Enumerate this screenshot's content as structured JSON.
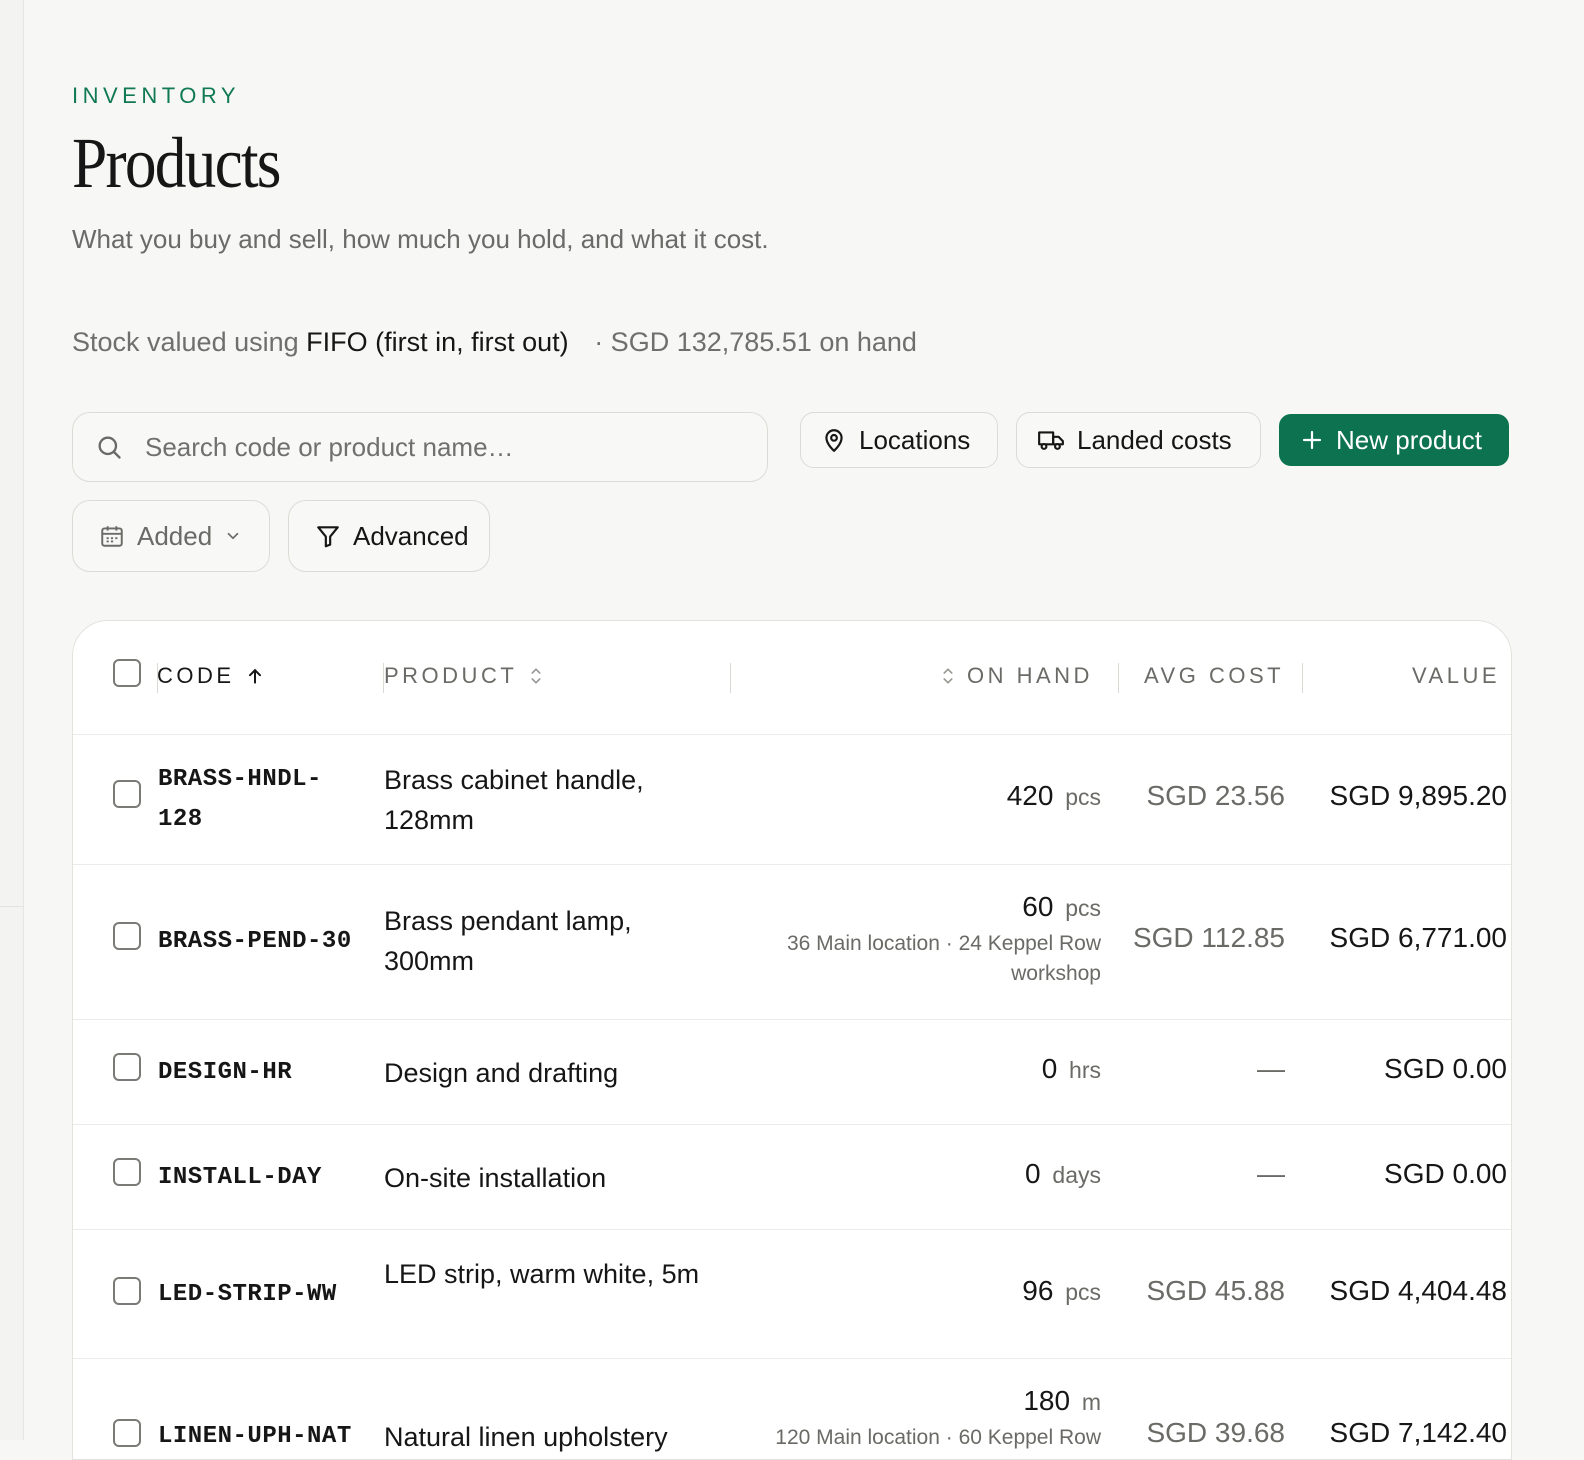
{
  "header": {
    "eyebrow": "INVENTORY",
    "title": "Products",
    "subtitle": "What you buy and sell, how much you hold, and what it cost.",
    "valuation_prefix": "Stock valued using",
    "valuation_method": "FIFO (first in, first out)",
    "valuation_total": "· SGD 132,785.51 on hand"
  },
  "toolbar": {
    "search_placeholder": "Search code or product name…",
    "locations_label": "Locations",
    "landed_costs_label": "Landed costs",
    "new_product_label": "New product",
    "added_filter_label": "Added",
    "advanced_label": "Advanced"
  },
  "table": {
    "columns": {
      "code": "CODE",
      "product": "PRODUCT",
      "on_hand": "ON HAND",
      "avg_cost": "AVG COST",
      "value": "VALUE"
    },
    "rows": [
      {
        "code": "BRASS-HNDL-\n128",
        "product": "Brass cabinet handle, 128mm",
        "qty": "420",
        "unit": "pcs",
        "locations": "",
        "avg_cost": "SGD 23.56",
        "value": "SGD 9,895.20"
      },
      {
        "code": "BRASS-PEND-30",
        "product": "Brass pendant lamp, 300mm",
        "qty": "60",
        "unit": "pcs",
        "locations": "36 Main location · 24 Keppel Row workshop",
        "avg_cost": "SGD 112.85",
        "value": "SGD 6,771.00"
      },
      {
        "code": "DESIGN-HR",
        "product": "Design and drafting",
        "qty": "0",
        "unit": "hrs",
        "locations": "",
        "avg_cost": "—",
        "value": "SGD 0.00"
      },
      {
        "code": "INSTALL-DAY",
        "product": "On-site installation",
        "qty": "0",
        "unit": "days",
        "locations": "",
        "avg_cost": "—",
        "value": "SGD 0.00"
      },
      {
        "code": "LED-STRIP-WW",
        "product": "LED strip, warm white, 5m",
        "qty": "96",
        "unit": "pcs",
        "locations": "",
        "avg_cost": "SGD 45.88",
        "value": "SGD 4,404.48"
      },
      {
        "code": "LINEN-UPH-NAT",
        "product": "Natural linen upholstery",
        "qty": "180",
        "unit": "m",
        "locations": "120 Main location · 60 Keppel Row",
        "avg_cost": "SGD 39.68",
        "value": "SGD 7,142.40"
      }
    ]
  },
  "colors": {
    "accent": "#0c7250",
    "eyebrow": "#117a54",
    "background": "#f7f7f5"
  },
  "icons": {
    "search": "search-icon",
    "locations": "map-pin-icon",
    "landed_costs": "truck-icon",
    "new_product": "plus-icon",
    "added": "calendar-icon",
    "advanced": "filter-icon",
    "sort_asc": "arrow-up-icon",
    "sort_both": "sort-icon"
  }
}
